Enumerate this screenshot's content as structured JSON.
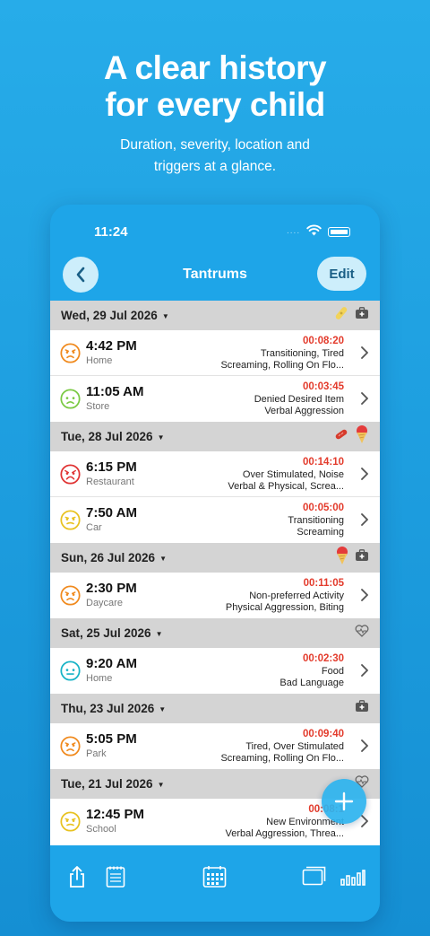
{
  "promo": {
    "headline_line1": "A clear history",
    "headline_line2": "for every child",
    "subtitle_line1": "Duration, severity, location and",
    "subtitle_line2": "triggers at a glance."
  },
  "status_bar": {
    "time": "11:24",
    "signal_dots": "....",
    "wifi_icon": "wifi-icon",
    "battery_icon": "battery-icon"
  },
  "nav": {
    "back_icon": "chevron-left-icon",
    "title": "Tantrums",
    "edit_label": "Edit"
  },
  "colors": {
    "accent": "#1ea5e8",
    "duration": "#e33b2c",
    "section_bg": "#d4d4d4"
  },
  "sections": [
    {
      "date": "Wed, 29 Jul 2026",
      "icons": [
        "bandage-icon",
        "medical-kit-icon"
      ],
      "rows": [
        {
          "face": "angry-orange-face-icon",
          "time": "4:42 PM",
          "location": "Home",
          "duration": "00:08:20",
          "line1": "Transitioning, Tired",
          "line2": "Screaming, Rolling On Flo..."
        },
        {
          "face": "sad-green-face-icon",
          "time": "11:05 AM",
          "location": "Store",
          "duration": "00:03:45",
          "line1": "Denied Desired Item",
          "line2": "Verbal Aggression"
        }
      ]
    },
    {
      "date": "Tue, 28 Jul 2026",
      "icons": [
        "sausage-icon",
        "ice-cream-icon"
      ],
      "rows": [
        {
          "face": "furious-red-face-icon",
          "time": "6:15 PM",
          "location": "Restaurant",
          "duration": "00:14:10",
          "line1": "Over Stimulated, Noise",
          "line2": "Verbal & Physical, Screa..."
        },
        {
          "face": "annoyed-yellow-face-icon",
          "time": "7:50 AM",
          "location": "Car",
          "duration": "00:05:00",
          "line1": "Transitioning",
          "line2": "Screaming"
        }
      ]
    },
    {
      "date": "Sun, 26 Jul 2026",
      "icons": [
        "ice-cream-icon",
        "medical-kit-icon"
      ],
      "rows": [
        {
          "face": "angry-orange-face-icon",
          "time": "2:30 PM",
          "location": "Daycare",
          "duration": "00:11:05",
          "line1": "Non-preferred Activity",
          "line2": "Physical Aggression, Biting"
        }
      ]
    },
    {
      "date": "Sat, 25 Jul 2026",
      "icons": [
        "heart-pulse-icon"
      ],
      "rows": [
        {
          "face": "neutral-teal-face-icon",
          "time": "9:20 AM",
          "location": "Home",
          "duration": "00:02:30",
          "line1": "Food",
          "line2": "Bad Language"
        }
      ]
    },
    {
      "date": "Thu, 23 Jul 2026",
      "icons": [
        "medical-kit-icon"
      ],
      "rows": [
        {
          "face": "angry-orange-face-icon",
          "time": "5:05 PM",
          "location": "Park",
          "duration": "00:09:40",
          "line1": "Tired, Over Stimulated",
          "line2": "Screaming, Rolling On Flo..."
        }
      ]
    },
    {
      "date": "Tue, 21 Jul 2026",
      "icons": [
        "heart-pulse-icon"
      ],
      "rows": [
        {
          "face": "annoyed-yellow-face-icon",
          "time": "12:45 PM",
          "location": "School",
          "duration": "00:08:1",
          "line1": "New Environment",
          "line2": "Verbal Aggression, Threa..."
        }
      ]
    }
  ],
  "fab": {
    "icon": "plus-icon"
  },
  "toolbar": {
    "icons": [
      "share-icon",
      "notes-icon",
      "calendar-icon",
      "cards-icon",
      "bar-chart-icon"
    ]
  }
}
